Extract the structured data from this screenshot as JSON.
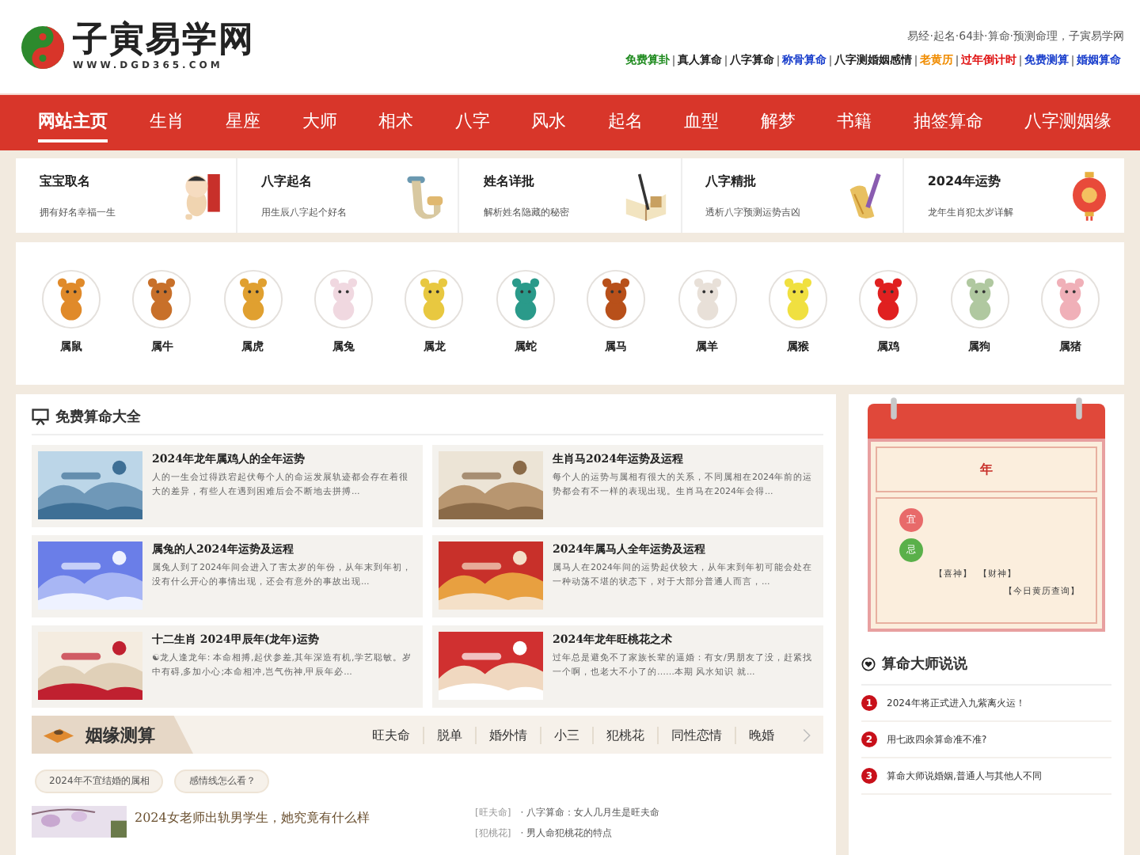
{
  "header": {
    "logo_text": "子寅易学网",
    "logo_url": "WWW.DGD365.COM",
    "tagline": "易经·起名·64卦·算命·预测命理，子寅易学网",
    "links": [
      {
        "label": "免费算卦",
        "color": "#1e8a1e"
      },
      {
        "label": "真人算命",
        "color": "#222222"
      },
      {
        "label": "八字算命",
        "color": "#222222"
      },
      {
        "label": "称骨算命",
        "color": "#1a3fcc"
      },
      {
        "label": "八字测婚姻感情",
        "color": "#222222"
      },
      {
        "label": "老黄历",
        "color": "#f08c00"
      },
      {
        "label": "过年倒计时",
        "color": "#e01010"
      },
      {
        "label": "免费测算",
        "color": "#1a3fcc"
      },
      {
        "label": "婚姻算命",
        "color": "#1a3fcc"
      }
    ]
  },
  "nav": [
    {
      "label": "网站主页",
      "selected": true
    },
    {
      "label": "生肖",
      "selected": false
    },
    {
      "label": "星座",
      "selected": false
    },
    {
      "label": "大师",
      "selected": false
    },
    {
      "label": "相术",
      "selected": false
    },
    {
      "label": "八字",
      "selected": false
    },
    {
      "label": "风水",
      "selected": false
    },
    {
      "label": "起名",
      "selected": false
    },
    {
      "label": "血型",
      "selected": false
    },
    {
      "label": "解梦",
      "selected": false
    },
    {
      "label": "书籍",
      "selected": false
    },
    {
      "label": "抽签算命",
      "selected": false
    },
    {
      "label": "八字测姻缘",
      "selected": false
    }
  ],
  "features": [
    {
      "title": "宝宝取名",
      "subtitle": "拥有好名幸福一生",
      "kind": "baby"
    },
    {
      "title": "八字起名",
      "subtitle": "用生辰八字起个好名",
      "kind": "scroll"
    },
    {
      "title": "姓名详批",
      "subtitle": "解析姓名隐藏的秘密",
      "kind": "book"
    },
    {
      "title": "八字精批",
      "subtitle": "透析八字预测运势吉凶",
      "kind": "brush"
    },
    {
      "title": "2024年运势",
      "subtitle": "龙年生肖犯太岁详解",
      "kind": "lantern"
    }
  ],
  "zodiac": [
    {
      "label": "属鼠",
      "color": "#e08a2a"
    },
    {
      "label": "属牛",
      "color": "#c8702a"
    },
    {
      "label": "属虎",
      "color": "#e0a030"
    },
    {
      "label": "属兔",
      "color": "#f0d8e0"
    },
    {
      "label": "属龙",
      "color": "#e8c840"
    },
    {
      "label": "属蛇",
      "color": "#2a9a8a"
    },
    {
      "label": "属马",
      "color": "#b8501a"
    },
    {
      "label": "属羊",
      "color": "#e8e0d8"
    },
    {
      "label": "属猴",
      "color": "#f0e040"
    },
    {
      "label": "属鸡",
      "color": "#e02020"
    },
    {
      "label": "属狗",
      "color": "#b0c8a0"
    },
    {
      "label": "属猪",
      "color": "#f0b0b8"
    }
  ],
  "free_section": {
    "title": "免费算命大全",
    "articles": [
      {
        "title": "2024年龙年属鸡人的全年运势",
        "excerpt": "人的一生会过得跌宕起伏每个人的命运发展轨迹都会存在着很大的差异，有些人在遇到困难后会不断地去拼搏..."
      },
      {
        "title": "生肖马2024年运势及运程",
        "excerpt": "每个人的运势与属相有很大的关系，不同属相在2024年前的运势都会有不一样的表现出现。生肖马在2024年会得..."
      },
      {
        "title": "属兔的人2024年运势及运程",
        "excerpt": "属兔人到了2024年间会进入了害太岁的年份，从年末到年初，没有什么开心的事情出现，还会有意外的事故出现..."
      },
      {
        "title": "2024年属马人全年运势及运程",
        "excerpt": "属马人在2024年间的运势起伏较大，从年末到年初可能会处在一种动荡不堪的状态下，对于大部分普通人而言，..."
      },
      {
        "title": "十二生肖 2024甲辰年(龙年)运势",
        "excerpt": "☯龙人逢龙年: 本命相搏,起伏参差,其年深造有机,学艺聪敏。岁中有碍,多加小心;本命相冲,岂气伤神,甲辰年必..."
      },
      {
        "title": "2024年龙年旺桃花之术",
        "excerpt": "过年总是避免不了家族长辈的逼婚：有女/男朋友了没，赶紧找一个啊，也老大不小了的……本期 风水知识 就..."
      }
    ]
  },
  "marriage": {
    "title": "姻缘测算",
    "tabs": [
      "旺夫命",
      "脱单",
      "婚外情",
      "小三",
      "犯桃花",
      "同性恋情",
      "晚婚"
    ],
    "tags": [
      "2024年不宜结婚的属相",
      "感情线怎么看？"
    ],
    "article_title": "2024女老师出轨男学生，她究竟有什么样",
    "related": [
      {
        "tag": "[旺夫命]",
        "title": "· 八字算命：女人几月生是旺夫命"
      },
      {
        "tag": "[犯桃花]",
        "title": "· 男人命犯桃花的特点"
      }
    ]
  },
  "calendar": {
    "year": "年",
    "suitable": "宜",
    "avoid": "忌",
    "gods": [
      "【喜神】",
      "【财神】"
    ],
    "query": "【今日黄历查询】"
  },
  "sidebar": {
    "title": "算命大师说说",
    "items": [
      {
        "number": "1",
        "text": "2024年将正式进入九紫离火运！"
      },
      {
        "number": "2",
        "text": "用七政四余算命准不准?"
      },
      {
        "number": "3",
        "text": "算命大师说婚姻,普通人与其他人不同"
      }
    ]
  }
}
